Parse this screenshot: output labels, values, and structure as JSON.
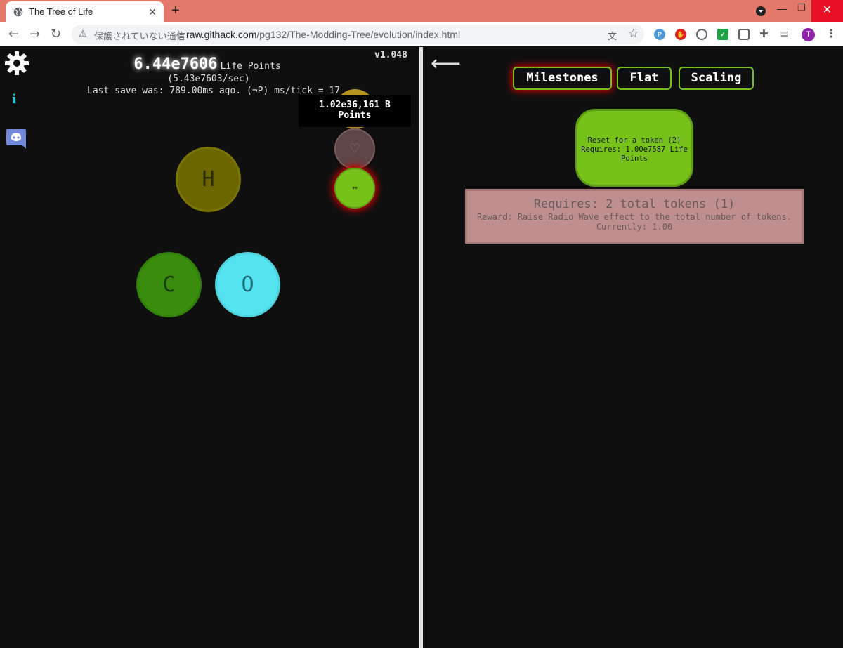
{
  "browser": {
    "tab_title": "The Tree of Life",
    "tab_close": "✕",
    "new_tab": "+",
    "security_text": "保護されていない通信",
    "url_host": "raw.githack.com",
    "url_path": "/pg132/The-Modding-Tree/evolution/index.html",
    "avatar_letter": "T",
    "icons": [
      "globe-icon",
      "back-icon",
      "forward-icon",
      "reload-icon",
      "warning-icon",
      "translate-icon",
      "star-icon",
      "extensions-icon",
      "menu-icon"
    ],
    "close_color": "#e81123",
    "tabbar_color": "#e4786a"
  },
  "game": {
    "points_value": "6.44e7606",
    "points_unit": "Life Points",
    "rate": "(5.43e7603/sec)",
    "save_info": "Last save was: 789.00ms ago. (¬P) ms/tick = 17",
    "version": "v1.048",
    "info_label": "i",
    "nodes": {
      "h": "H",
      "c": "C",
      "o": "O",
      "heart": "♡",
      "wave": "↭"
    },
    "tooltip_line1": "1.02e36,161 B",
    "tooltip_line2": "Points",
    "back": "⟵",
    "tabs": {
      "milestones": "Milestones",
      "flat": "Flat",
      "scaling": "Scaling"
    },
    "reset": {
      "line1": "Reset for a token (2)",
      "line2": "Requires: 1.00e7587 Life",
      "line3": "Points"
    },
    "milestone": {
      "title": "Requires: 2 total tokens (1)",
      "reward": "Reward: Raise Radio Wave effect to the total number of tokens.",
      "current": "Currently: 1.00"
    },
    "colors": {
      "accent_green": "#77c21a",
      "glow_red": "#d00000",
      "node_h": "#6b6600",
      "node_c": "#3a8c0e",
      "node_o": "#55e3ef",
      "milestone_bg": "#bf8f8f"
    }
  }
}
